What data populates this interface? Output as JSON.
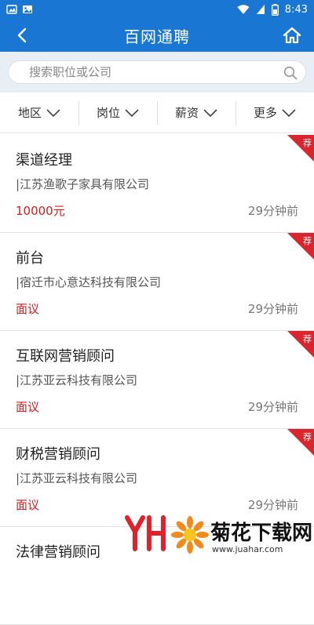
{
  "status_bar": {
    "time": "8:43"
  },
  "app_bar": {
    "title": "百网通聘"
  },
  "search": {
    "placeholder": "搜索职位或公司"
  },
  "filters": [
    {
      "label": "地区"
    },
    {
      "label": "岗位"
    },
    {
      "label": "薪资"
    },
    {
      "label": "更多"
    }
  ],
  "jobs": [
    {
      "title": "渠道经理",
      "company": "|江苏渔歌子家具有限公司",
      "salary": "10000元",
      "time": "29分钟前",
      "badge": "荐"
    },
    {
      "title": "前台",
      "company": "|宿迁市心意达科技有限公司",
      "salary": "面议",
      "time": "29分钟前",
      "badge": "荐"
    },
    {
      "title": "互联网营销顾问",
      "company": "|江苏亚云科技有限公司",
      "salary": "面议",
      "time": "29分钟前",
      "badge": "荐"
    },
    {
      "title": "财税营销顾问",
      "company": "|江苏亚云科技有限公司",
      "salary": "面议",
      "time": "29分钟前",
      "badge": "荐"
    },
    {
      "title": "法律营销顾问",
      "company": "",
      "salary": "",
      "time": "",
      "badge": ""
    }
  ],
  "watermark": {
    "name": "菊花下载网",
    "url": "www.juahar.com"
  },
  "colors": {
    "primary": "#1976d2",
    "salary_red": "#d71c1c",
    "badge_red": "#d9262e"
  }
}
